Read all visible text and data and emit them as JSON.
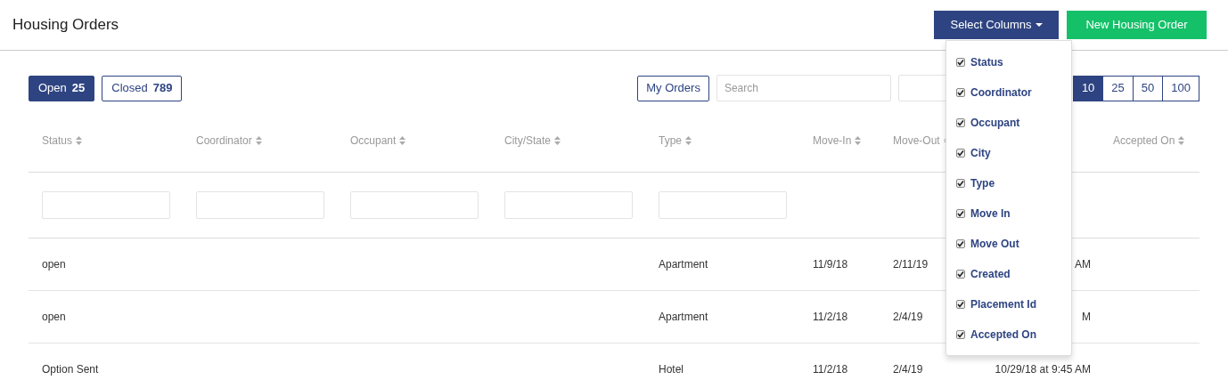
{
  "title": "Housing Orders",
  "header_buttons": [
    {
      "label": "Select Columns",
      "kind": "dropdown"
    },
    {
      "label": "New Housing Order",
      "kind": "primary"
    }
  ],
  "status_tabs": [
    {
      "label": "Open",
      "count": "25",
      "selected": true
    },
    {
      "label": "Closed",
      "count": "789",
      "selected": false
    }
  ],
  "my_orders": "My Orders",
  "search": {
    "placeholder": "Search"
  },
  "page_sizes": [
    {
      "label": "10",
      "selected": true
    },
    {
      "label": "25",
      "selected": false
    },
    {
      "label": "50",
      "selected": false
    },
    {
      "label": "100",
      "selected": false
    }
  ],
  "columns": [
    {
      "label": "Status",
      "filter": true
    },
    {
      "label": "Coordinator",
      "filter": true
    },
    {
      "label": "Occupant",
      "filter": true
    },
    {
      "label": "City/State",
      "filter": true
    },
    {
      "label": "Type",
      "filter": true
    },
    {
      "label": "Move-In",
      "filter": false
    },
    {
      "label": "Move-Out",
      "filter": false
    },
    {
      "filter": false
    },
    {
      "label": "Accepted On",
      "filter": false
    }
  ],
  "rows": [
    {
      "cells": [
        "open",
        "",
        "",
        "",
        "Apartment",
        "11/9/18",
        "2/11/19",
        "AM",
        ""
      ]
    },
    {
      "cells": [
        "open",
        "",
        "",
        "",
        "Apartment",
        "11/2/18",
        "2/4/19",
        "M",
        ""
      ]
    },
    {
      "cells": [
        "Option Sent",
        "",
        "",
        "",
        "Hotel",
        "11/2/18",
        "2/4/19",
        "10/29/18 at 9:45 AM",
        ""
      ]
    }
  ],
  "column_menu": [
    {
      "label": "Status",
      "checked": true
    },
    {
      "label": "Coordinator",
      "checked": true
    },
    {
      "label": "Occupant",
      "checked": true
    },
    {
      "label": "City",
      "checked": true
    },
    {
      "label": "Type",
      "checked": true
    },
    {
      "label": "Move In",
      "checked": true
    },
    {
      "label": "Move Out",
      "checked": true
    },
    {
      "label": "Created",
      "checked": true
    },
    {
      "label": "Placement Id",
      "checked": true
    },
    {
      "label": "Accepted On",
      "checked": true
    }
  ]
}
